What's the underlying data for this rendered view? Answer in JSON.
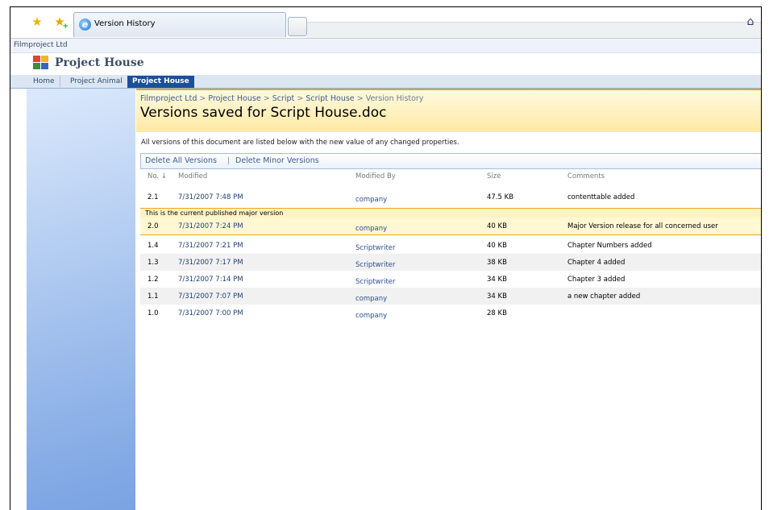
{
  "browser": {
    "tab_title": "Version History"
  },
  "site": {
    "name": "Filmproject Ltd",
    "title": "Project House",
    "nav": [
      "Home",
      "Project Animal",
      "Project House"
    ]
  },
  "page": {
    "breadcrumb": [
      "Filmproject Ltd",
      "Project House",
      "Script",
      "Script House",
      "Version History"
    ],
    "breadcrumb_sep": ">",
    "title": "Versions saved for Script House.doc",
    "description": "All versions of this document are listed below with the new value of any changed properties.",
    "actions": {
      "delete_all": "Delete All Versions",
      "separator": "|",
      "delete_minor": "Delete Minor Versions"
    }
  },
  "table": {
    "headers": {
      "no": "No. ↓",
      "modified": "Modified",
      "modified_by": "Modified By",
      "size": "Size",
      "comments": "Comments"
    },
    "published_banner": "This is the current published major version",
    "rows": [
      {
        "no": "2.1",
        "modified": "7/31/2007 7:48 PM",
        "by": "company",
        "size": "47.5 KB",
        "comments": "contenttable added"
      },
      {
        "no": "2.0",
        "modified": "7/31/2007 7:24 PM",
        "by": "company",
        "size": "40 KB",
        "comments": "Major Version release for all concerned user"
      },
      {
        "no": "1.4",
        "modified": "7/31/2007 7:21 PM",
        "by": "Scriptwriter",
        "size": "40 KB",
        "comments": "Chapter Numbers added"
      },
      {
        "no": "1.3",
        "modified": "7/31/2007 7:17 PM",
        "by": "Scriptwriter",
        "size": "38 KB",
        "comments": "Chapter 4 added"
      },
      {
        "no": "1.2",
        "modified": "7/31/2007 7:14 PM",
        "by": "Scriptwriter",
        "size": "34 KB",
        "comments": "Chapter 3 added"
      },
      {
        "no": "1.1",
        "modified": "7/31/2007 7:07 PM",
        "by": "company",
        "size": "34 KB",
        "comments": "a new chapter added"
      },
      {
        "no": "1.0",
        "modified": "7/31/2007 7:00 PM",
        "by": "company",
        "size": "28 KB",
        "comments": ""
      }
    ]
  },
  "colors": {
    "accent": "#e9a51b",
    "link": "#1f3f78",
    "nav_selected": "#1b4f99"
  },
  "icons": [
    "favorites-star-icon",
    "add-favorites-icon",
    "ie-icon",
    "home-icon",
    "site-logo-icon"
  ]
}
